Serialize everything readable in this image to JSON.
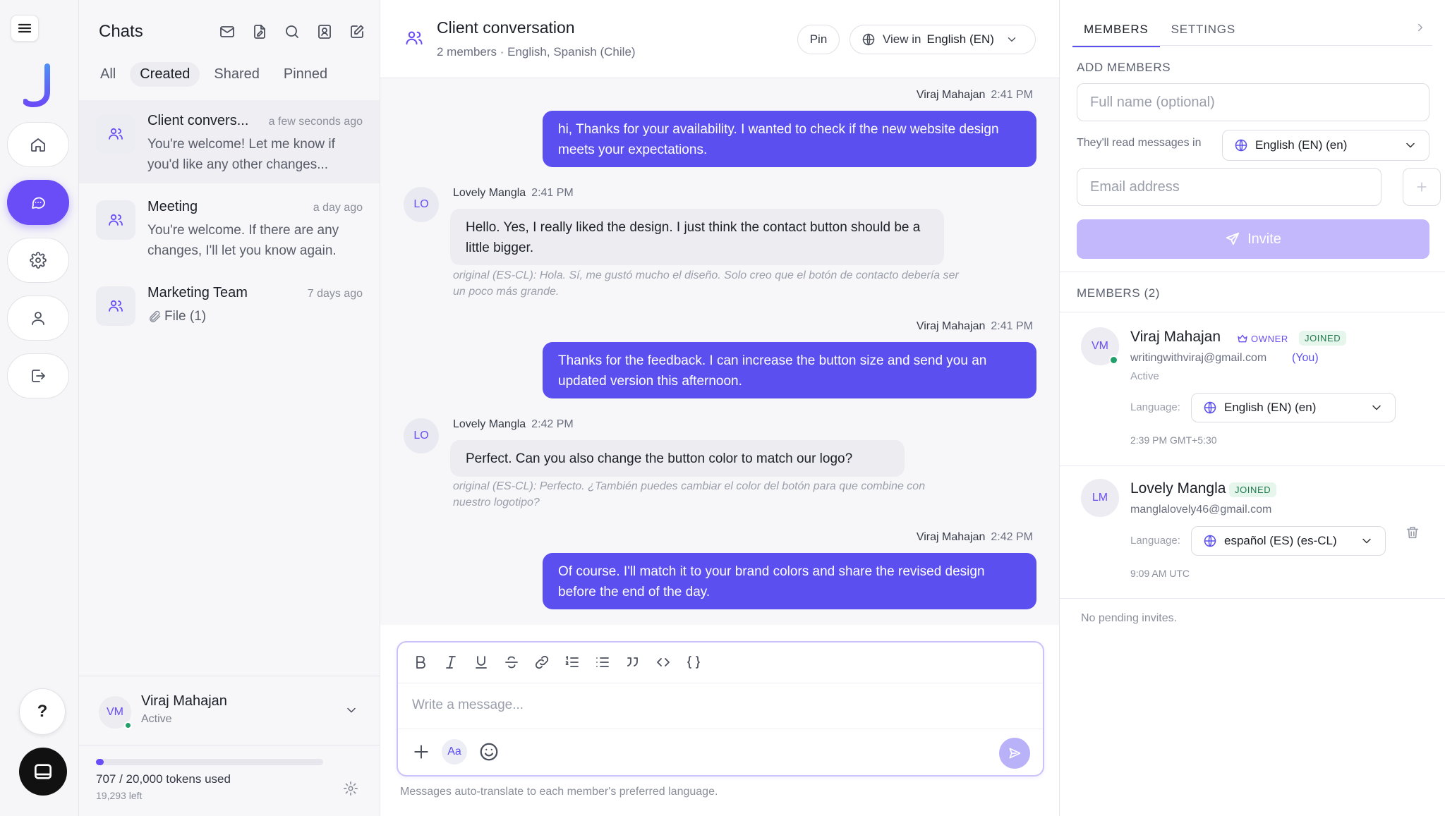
{
  "colors": {
    "accent": "#6a4df6",
    "bubble_out": "#5b4ff0",
    "online": "#22a06b",
    "joined_badge": "#1e7a4c"
  },
  "chats": {
    "title": "Chats",
    "tabs": [
      "All",
      "Created",
      "Shared",
      "Pinned"
    ],
    "active_tab": "Created",
    "items": [
      {
        "name": "Client convers...",
        "time": "a few seconds ago",
        "preview": "You're welcome! Let me know if you'd like any other changes..."
      },
      {
        "name": "Meeting",
        "time": "a day ago",
        "preview": "You're welcome. If there are any changes, I'll let you know again."
      },
      {
        "name": "Marketing Team",
        "time": "7 days ago",
        "preview": "File (1)"
      }
    ],
    "user": {
      "initials": "VM",
      "name": "Viraj Mahajan",
      "status": "Active"
    },
    "tokens": {
      "used_text": "707 / 20,000 tokens used",
      "left_text": "19,293 left",
      "fraction_used": 0.035
    }
  },
  "conversation": {
    "title": "Client conversation",
    "subtitle": "2 members · English, Spanish (Chile)",
    "pin_label": "Pin",
    "view_in_label": "View in",
    "view_in_value": "English (EN)",
    "messages": [
      {
        "sender": "Viraj Mahajan",
        "time": "2:41 PM",
        "text": "hi, Thanks for your availability. I wanted to check if the new website design meets your expectations."
      },
      {
        "sender": "Lovely Mangla",
        "initials": "LO",
        "time": "2:41 PM",
        "text": "Hello. Yes, I really liked the design. I just think the contact button should be a little bigger.",
        "original": "original (ES-CL): Hola. Sí, me gustó mucho el diseño. Solo creo que el botón de contacto debería ser un poco más grande."
      },
      {
        "sender": "Viraj Mahajan",
        "time": "2:41 PM",
        "text": "Thanks for the feedback. I can increase the button size and send you an updated version this afternoon."
      },
      {
        "sender": "Lovely Mangla",
        "initials": "LO",
        "time": "2:42 PM",
        "text": "Perfect. Can you also change the button color to match our logo?",
        "original": "original (ES-CL): Perfecto. ¿También puedes cambiar el color del botón para que combine con nuestro logotipo?"
      },
      {
        "sender": "Viraj Mahajan",
        "time": "2:42 PM",
        "text": "Of course. I'll match it to your brand colors and share the revised design before the end of the day."
      }
    ],
    "composer": {
      "placeholder": "Write a message...",
      "aa_label": "Aa"
    },
    "note": "Messages auto-translate to each member's preferred language."
  },
  "right_panel": {
    "tabs": [
      "MEMBERS",
      "SETTINGS"
    ],
    "active_tab": "MEMBERS",
    "add_members_label": "ADD MEMBERS",
    "full_name_placeholder": "Full name (optional)",
    "read_label": "They'll read messages in",
    "read_value": "English (EN) (en)",
    "email_placeholder": "Email address",
    "invite_label": "Invite",
    "members_label": "MEMBERS (2)",
    "members": [
      {
        "initials": "VM",
        "name": "Viraj Mahajan",
        "owner_badge": "OWNER",
        "joined_badge": "JOINED",
        "email": "writingwithviraj@gmail.com",
        "you": "(You)",
        "status": "Active",
        "language_label": "Language:",
        "language": "English (EN) (en)",
        "time": "2:39 PM GMT+5:30"
      },
      {
        "initials": "LM",
        "name": "Lovely Mangla",
        "joined_badge": "JOINED",
        "email": "manglalovely46@gmail.com",
        "language_label": "Language:",
        "language": "español (ES) (es-CL)",
        "time": "9:09 AM UTC"
      }
    ],
    "pending": "No pending invites."
  }
}
